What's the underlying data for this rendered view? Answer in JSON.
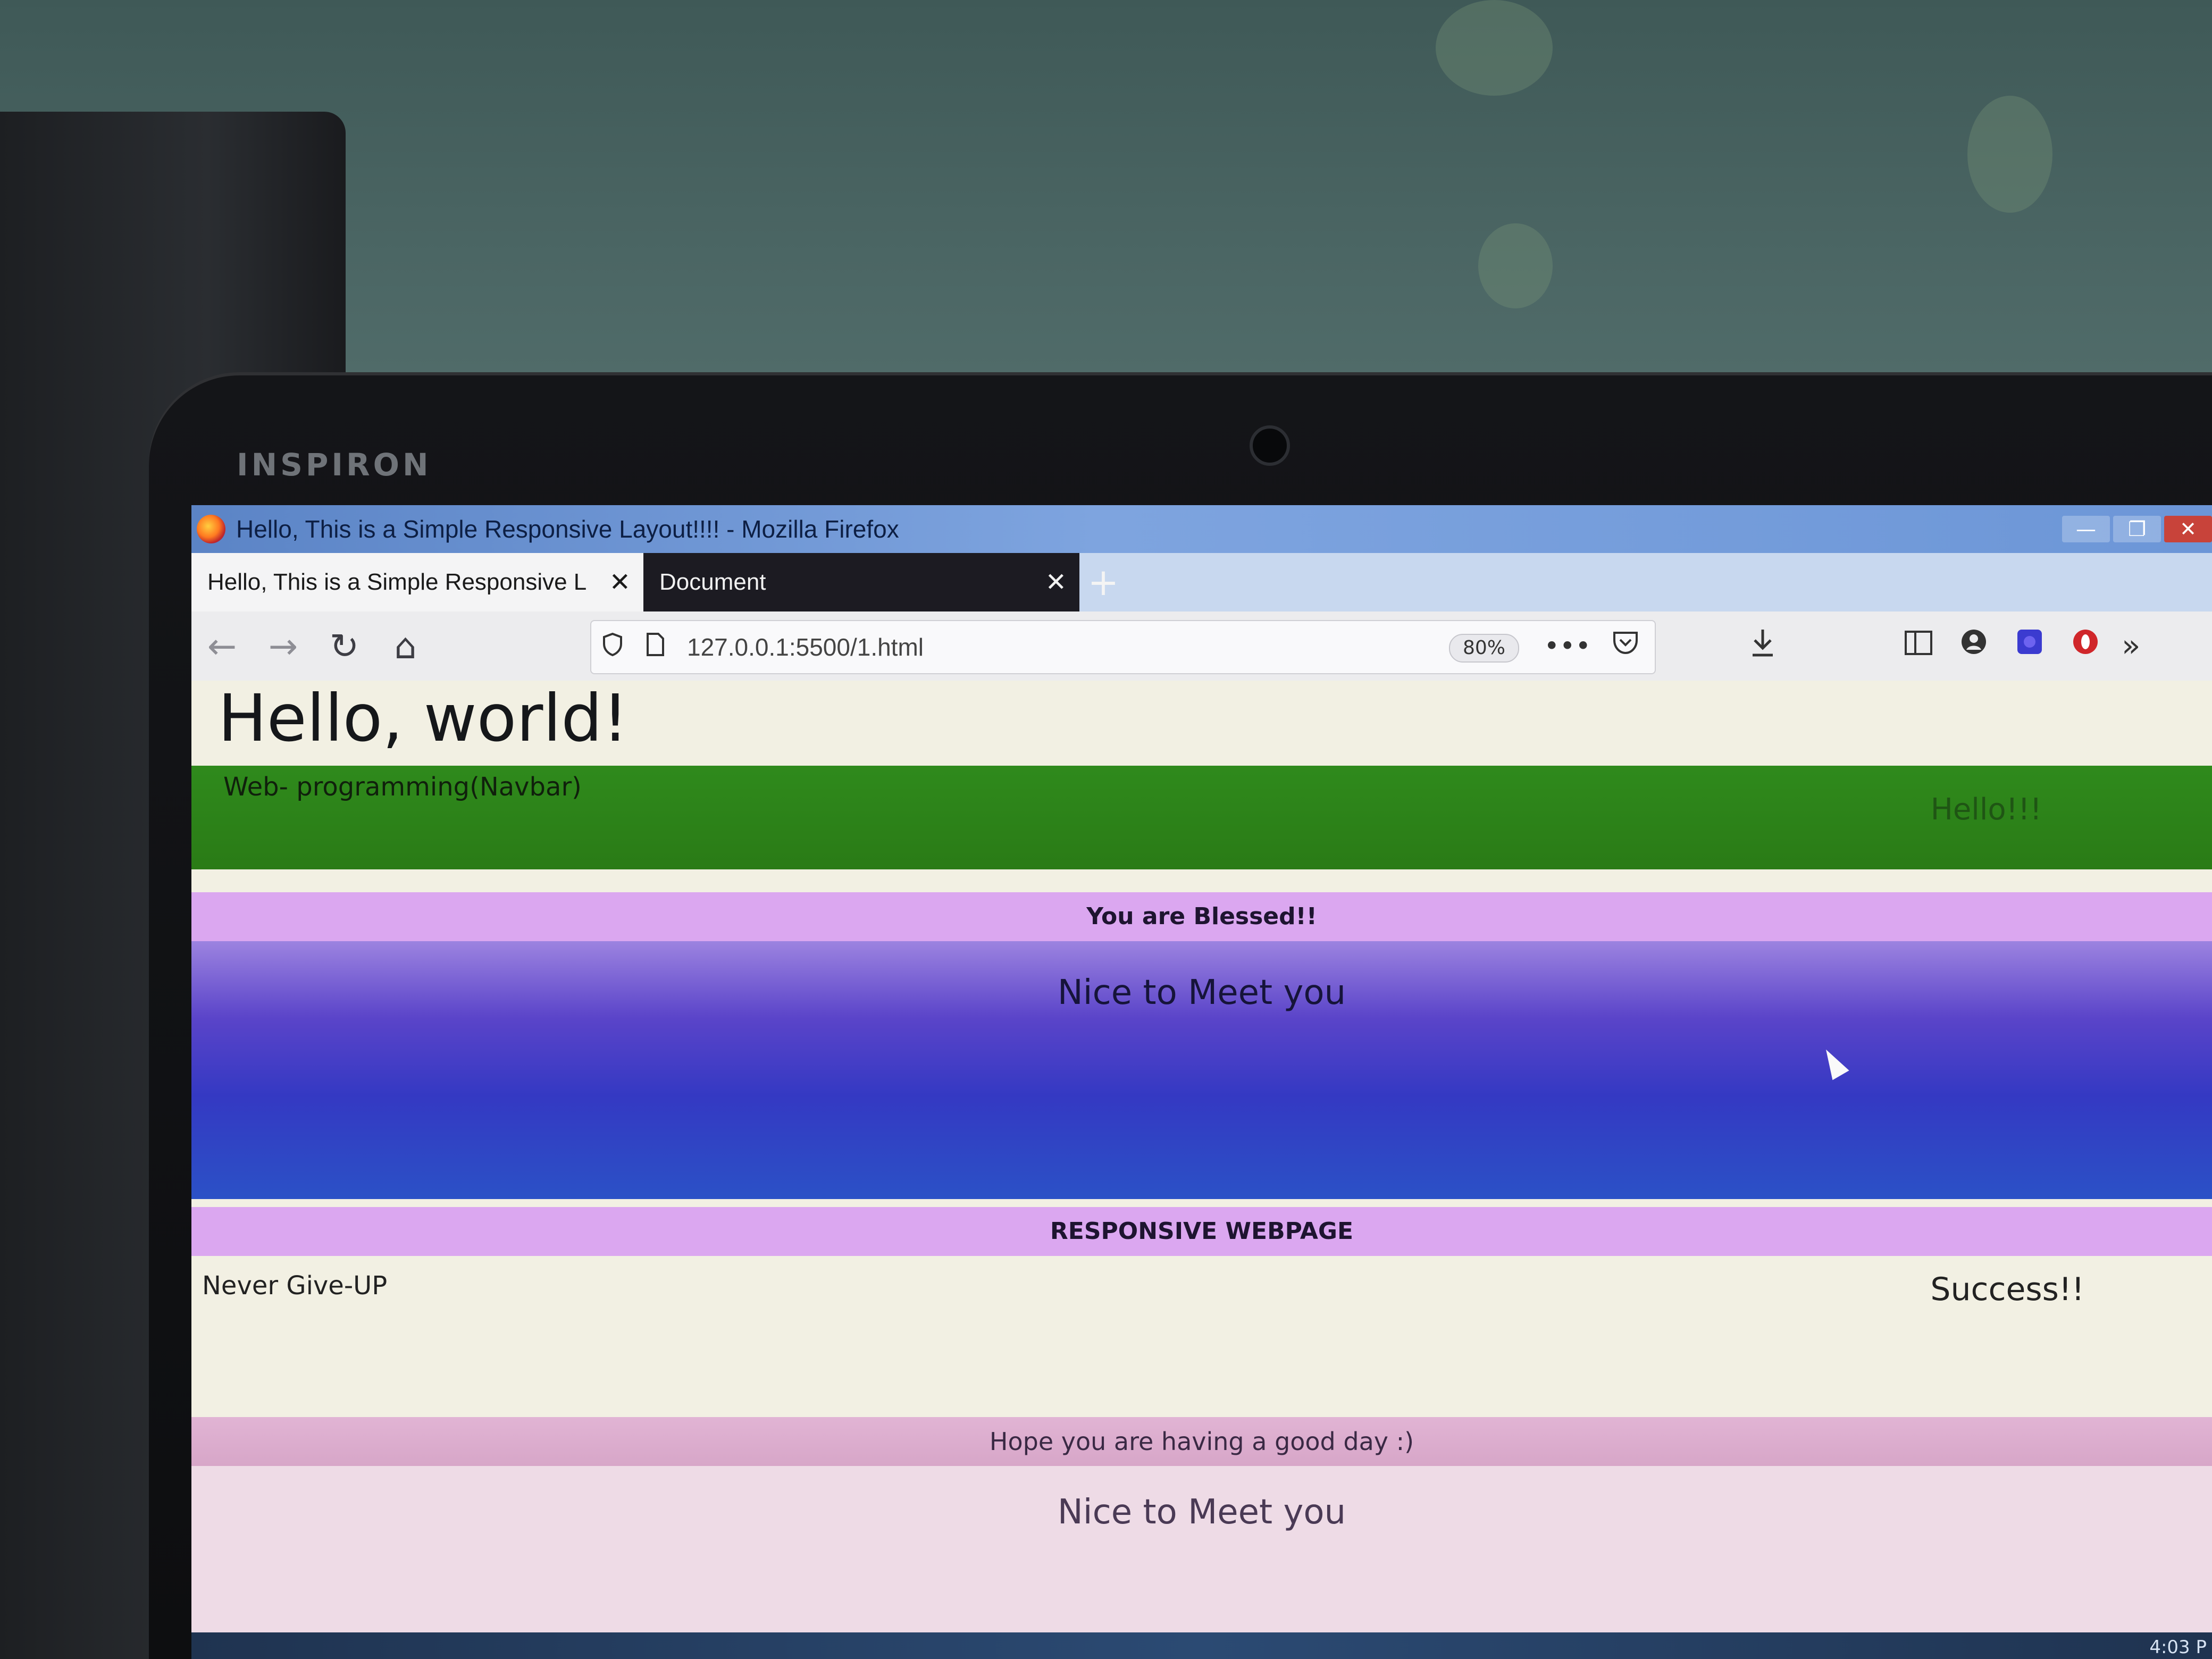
{
  "window": {
    "title": "Hello, This is a Simple Responsive Layout!!!! - Mozilla Firefox",
    "controls": {
      "minimize": "—",
      "maximize": "❐",
      "close": "✕"
    }
  },
  "device": {
    "brand": "INSPIRON"
  },
  "tabs": [
    {
      "label": "Hello, This is a Simple Responsive L",
      "close": "✕",
      "active": true
    },
    {
      "label": "Document",
      "close": "✕",
      "active": false
    }
  ],
  "new_tab_label": "+",
  "nav": {
    "back": "←",
    "forward": "→",
    "reload": "↻",
    "home": "⌂",
    "url": "127.0.0.1:5500/1.html",
    "zoom": "80%",
    "more": "•••",
    "overflow": "»"
  },
  "page": {
    "heading": "Hello, world!",
    "navbar_left": "Web- programming(Navbar)",
    "navbar_right": "Hello!!!",
    "blessed": "You are Blessed!!",
    "meet_1": "Nice to Meet you",
    "responsive": "RESPONSIVE WEBPAGE",
    "never_give_up": "Never Give-UP",
    "success": "Success!!",
    "hope": "Hope you are having a good day :)",
    "meet_2": "Nice to Meet you"
  },
  "taskbar": {
    "clock": "4:03 P"
  },
  "colors": {
    "navbar_green": "#2f8a1c",
    "pink_bar": "#dba7f0",
    "purple_gradient_top": "#9c83e0",
    "purple_gradient_bottom": "#2b51c6",
    "light_pink_bar": "#e1b4d4",
    "lavender_block": "#eedbe6",
    "page_background": "#f2f0e3"
  }
}
